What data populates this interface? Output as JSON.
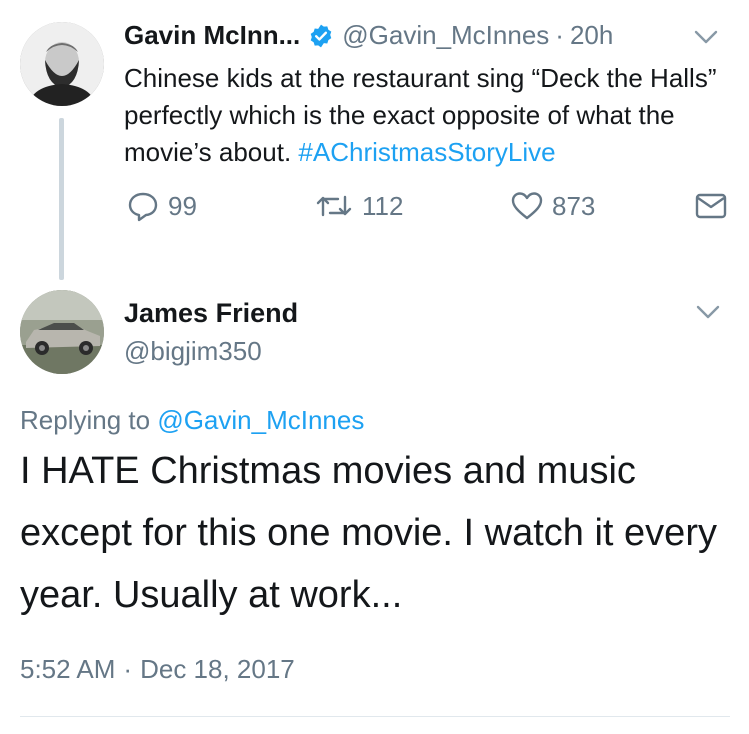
{
  "parent_tweet": {
    "author_name": "Gavin McInn...",
    "verified": true,
    "handle": "@Gavin_McInnes",
    "time": "20h",
    "text_plain": "Chinese kids at the restaurant sing “Deck the Halls” perfectly which is the exact opposite of what the movie’s about. ",
    "hashtag": "#AChristmasStoryLive",
    "reply_count": "99",
    "retweet_count": "112",
    "like_count": "873",
    "icons": [
      "reply-icon",
      "retweet-icon",
      "like-icon",
      "direct-message-icon",
      "chevron-down-icon",
      "verified-badge-icon"
    ]
  },
  "reply_tweet": {
    "author_name": "James Friend",
    "handle": "@bigjim350",
    "replying_prefix": "Replying to ",
    "replying_to": "@Gavin_McInnes",
    "text": "I HATE Christmas movies and music except for this one movie. I watch it every year. Usually at work...",
    "time": "5:52 AM",
    "separator": "·",
    "date": "Dec 18, 2017"
  },
  "colors": {
    "text": "#14171a",
    "secondary": "#657786",
    "accent": "#1da1f2",
    "thread_line": "#ccd6dd"
  }
}
